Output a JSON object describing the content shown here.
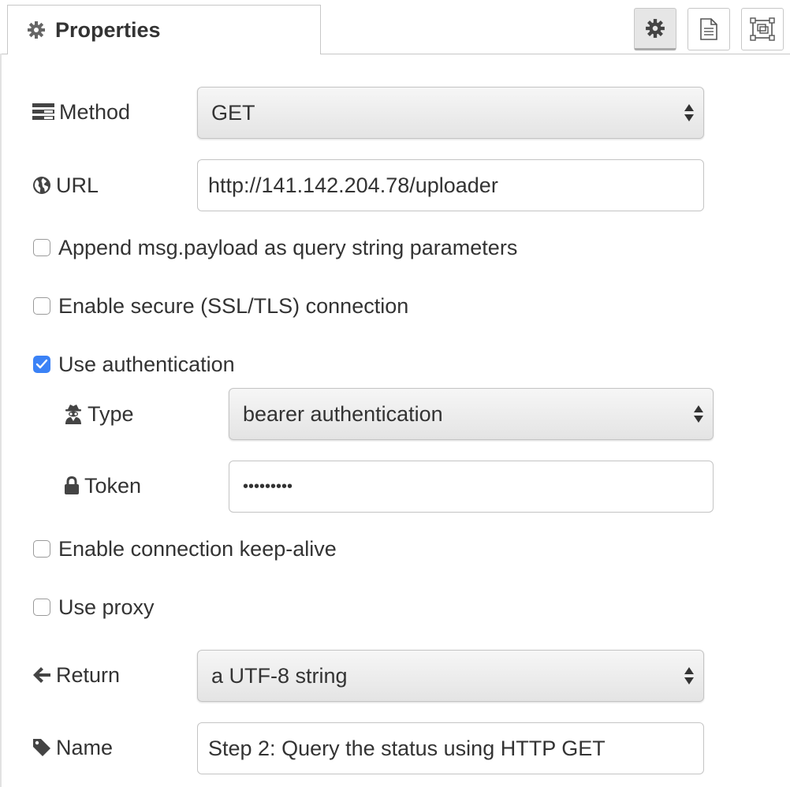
{
  "tab": {
    "label": "Properties",
    "icon": "gear-icon"
  },
  "toolbar": {
    "buttons": [
      {
        "name": "settings-tab-button",
        "icon": "gear-icon",
        "active": true
      },
      {
        "name": "description-tab-button",
        "icon": "document-icon",
        "active": false
      },
      {
        "name": "appearance-tab-button",
        "icon": "frame-icon",
        "active": false
      }
    ]
  },
  "form": {
    "method": {
      "label": "Method",
      "icon": "list-icon",
      "value": "GET"
    },
    "url": {
      "label": "URL",
      "icon": "globe-icon",
      "value": "http://141.142.204.78/uploader"
    },
    "append_payload": {
      "label": "Append msg.payload as query string parameters",
      "checked": false
    },
    "secure": {
      "label": "Enable secure (SSL/TLS) connection",
      "checked": false
    },
    "use_auth": {
      "label": "Use authentication",
      "checked": true
    },
    "auth_type": {
      "label": "Type",
      "icon": "user-secret-icon",
      "value": "bearer authentication"
    },
    "token": {
      "label": "Token",
      "icon": "lock-icon",
      "value": "•••••••••"
    },
    "keep_alive": {
      "label": "Enable connection keep-alive",
      "checked": false
    },
    "proxy": {
      "label": "Use proxy",
      "checked": false
    },
    "return": {
      "label": "Return",
      "icon": "arrow-left-icon",
      "value": "a UTF-8 string"
    },
    "name": {
      "label": "Name",
      "icon": "tag-icon",
      "value": "Step 2: Query the status using HTTP GET"
    }
  },
  "colors": {
    "accent": "#3b82f6",
    "border": "#c4c4c4",
    "text": "#333333"
  }
}
